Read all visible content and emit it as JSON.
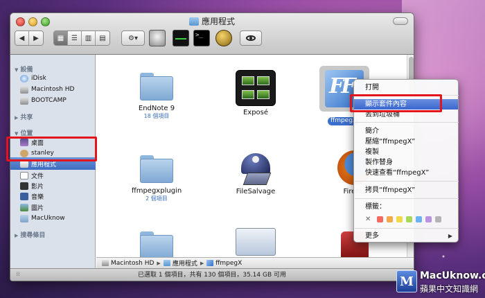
{
  "window": {
    "title": "應用程式"
  },
  "sidebar": {
    "sections": [
      {
        "label": "設備"
      },
      {
        "label": "共享"
      },
      {
        "label": "位置"
      },
      {
        "label": "搜尋條目"
      }
    ],
    "devices": [
      {
        "label": "iDisk",
        "icon": "idisk-icon"
      },
      {
        "label": "Macintosh HD",
        "icon": "hard-drive-icon"
      },
      {
        "label": "BOOTCAMP",
        "icon": "hard-drive-icon"
      }
    ],
    "places": [
      {
        "label": "桌面",
        "icon": "desktop-icon"
      },
      {
        "label": "stanley",
        "icon": "home-icon"
      },
      {
        "label": "應用程式",
        "icon": "applications-icon",
        "selected": true
      },
      {
        "label": "文件",
        "icon": "documents-icon"
      },
      {
        "label": "影片",
        "icon": "movies-icon"
      },
      {
        "label": "音樂",
        "icon": "music-icon"
      },
      {
        "label": "圖片",
        "icon": "pictures-icon"
      },
      {
        "label": "MacUknow",
        "icon": "folder-icon"
      }
    ]
  },
  "files": [
    {
      "label": "EndNote 9",
      "sub": "18 個項目"
    },
    {
      "label": "Exposé",
      "sub": ""
    },
    {
      "label": "ffmpegX",
      "sub": "",
      "selected": true
    },
    {
      "label": "ffmpegxplugin",
      "sub": "2 個項目"
    },
    {
      "label": "FileSalvage",
      "sub": ""
    },
    {
      "label": "Firefox",
      "sub": ""
    }
  ],
  "context_menu": {
    "items": [
      {
        "label": "打開"
      },
      {
        "label": "顯示套件內容",
        "highlighted": true
      },
      {
        "label": "丟到垃圾桶"
      },
      {
        "label": "簡介"
      },
      {
        "label": "壓縮“ffmpegX”"
      },
      {
        "label": "複製"
      },
      {
        "label": "製作替身"
      },
      {
        "label": "快速查看“ffmpegX”"
      },
      {
        "label": "拷貝“ffmpegX”"
      },
      {
        "label": "標籤："
      },
      {
        "label": "更多"
      }
    ],
    "label_colors": [
      "#f36a5f",
      "#f5a94b",
      "#f2d94a",
      "#a9d75a",
      "#6ab3f1",
      "#b993e0",
      "#b4b4b4"
    ]
  },
  "path_bar": [
    "Macintosh HD",
    "應用程式",
    "ffmpegX"
  ],
  "status_bar": {
    "text": "已選取 1 個項目，共有 130 個項目，35.14 GB 可用"
  },
  "watermark": {
    "line1": "MacUknow.com",
    "line2": "蘋果中文知識網"
  }
}
